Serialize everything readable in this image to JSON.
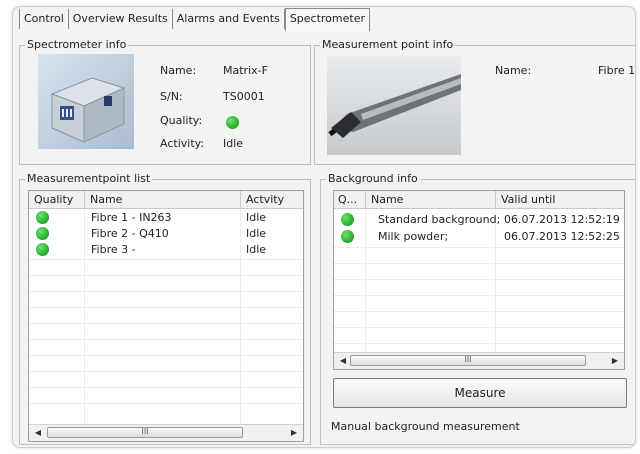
{
  "tabs": [
    {
      "label": "Control"
    },
    {
      "label": "Overview Results"
    },
    {
      "label": "Alarms and Events"
    },
    {
      "label": "Spectrometer"
    }
  ],
  "spectrometer_info": {
    "title": "Spectrometer info",
    "name_label": "Name:",
    "name_value": "Matrix-F",
    "sn_label": "S/N:",
    "sn_value": "TS0001",
    "quality_label": "Quality:",
    "quality_color": "#2eb82e",
    "activity_label": "Activity:",
    "activity_value": "Idle"
  },
  "measurement_point_info": {
    "title": "Measurement point info",
    "name_label": "Name:",
    "name_value": "Fibre 1"
  },
  "measurementpoint_list": {
    "title": "Measurementpoint list",
    "columns": [
      "Quality",
      "Name",
      "Actvity"
    ],
    "rows": [
      {
        "quality": "green",
        "name": "Fibre 1 - IN263",
        "activity": "Idle"
      },
      {
        "quality": "green",
        "name": "Fibre 2 - Q410",
        "activity": "Idle"
      },
      {
        "quality": "green",
        "name": "Fibre 3 -",
        "activity": "Idle"
      }
    ],
    "scroll_left": "◀",
    "scroll_right": "▶",
    "thumb_grip": "III"
  },
  "background_info": {
    "title": "Background info",
    "columns": [
      "Q...",
      "Name",
      "Valid until"
    ],
    "rows": [
      {
        "quality": "green",
        "name": "Standard background;",
        "valid_until": "06.07.2013 12:52:19"
      },
      {
        "quality": "green",
        "name": "Milk powder;",
        "valid_until": "06.07.2013 12:52:25"
      }
    ],
    "scroll_left": "◀",
    "scroll_right": "▶",
    "thumb_grip": "III",
    "measure_button": "Measure",
    "status_text": "Manual background measurement"
  }
}
